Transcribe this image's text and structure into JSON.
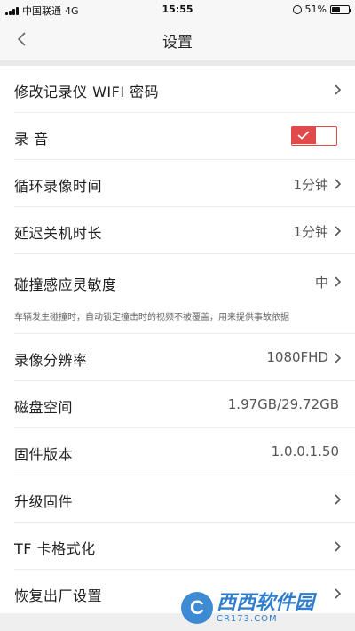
{
  "status_bar": {
    "carrier": "中国联通",
    "network": "4G",
    "time": "15:55",
    "battery": "51%"
  },
  "nav": {
    "title": "设置",
    "back_icon": "chevron-left-icon"
  },
  "rows": [
    {
      "label": "修改记录仪 WIFI 密码",
      "value": "",
      "arrow": true
    },
    {
      "label": "录 音",
      "toggle": true,
      "toggle_on": true
    },
    {
      "label": "循环录像时间",
      "value": "1分钟",
      "arrow": true
    },
    {
      "label": "延迟关机时长",
      "value": "1分钟",
      "arrow": true
    },
    {
      "label": "碰撞感应灵敏度",
      "value": "中",
      "arrow": true,
      "desc": "车辆发生碰撞时，自动锁定撞击时的视频不被覆盖，用来提供事故依据"
    },
    {
      "label": "录像分辨率",
      "value": "1080FHD",
      "arrow": true
    },
    {
      "label": "磁盘空间",
      "value": "1.97GB/29.72GB",
      "arrow": false
    },
    {
      "label": "固件版本",
      "value": "1.0.0.1.50",
      "arrow": false
    },
    {
      "label": "升级固件",
      "value": "",
      "arrow": true
    },
    {
      "label": "TF 卡格式化",
      "value": "",
      "arrow": true
    },
    {
      "label": "恢复出厂设置",
      "value": "",
      "arrow": true
    }
  ],
  "watermark": {
    "main": "西西软件园",
    "sub": "CR173.COM"
  },
  "colors": {
    "accent": "#e04a4a",
    "watermark": "#1a6fc9"
  }
}
